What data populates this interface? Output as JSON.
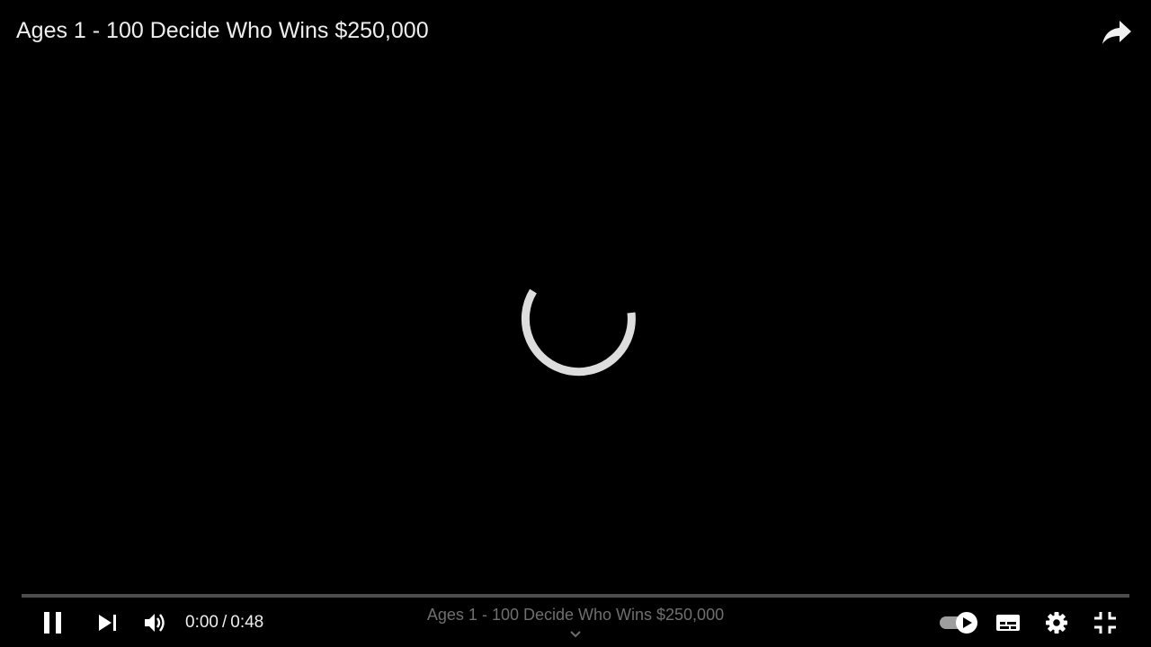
{
  "video": {
    "title": "Ages 1 - 100 Decide Who Wins $250,000"
  },
  "playback": {
    "current_time": "0:00",
    "separator": "/",
    "duration": "0:48",
    "progress": 0
  },
  "bottom_bar": {
    "title": "Ages 1 - 100 Decide Who Wins $250,000"
  },
  "icons": {
    "share": "share-icon",
    "loading": "loading-spinner-icon",
    "pause": "pause-icon",
    "next": "next-icon",
    "volume": "volume-icon",
    "autoplay": "autoplay-toggle-icon",
    "subtitles": "subtitles-icon",
    "settings": "gear-icon",
    "exit_fullscreen": "exit-fullscreen-icon",
    "chevron": "chevron-down-icon"
  },
  "colors": {
    "background": "#000000",
    "text": "#eeeeee",
    "progress_played": "#ff0000"
  }
}
